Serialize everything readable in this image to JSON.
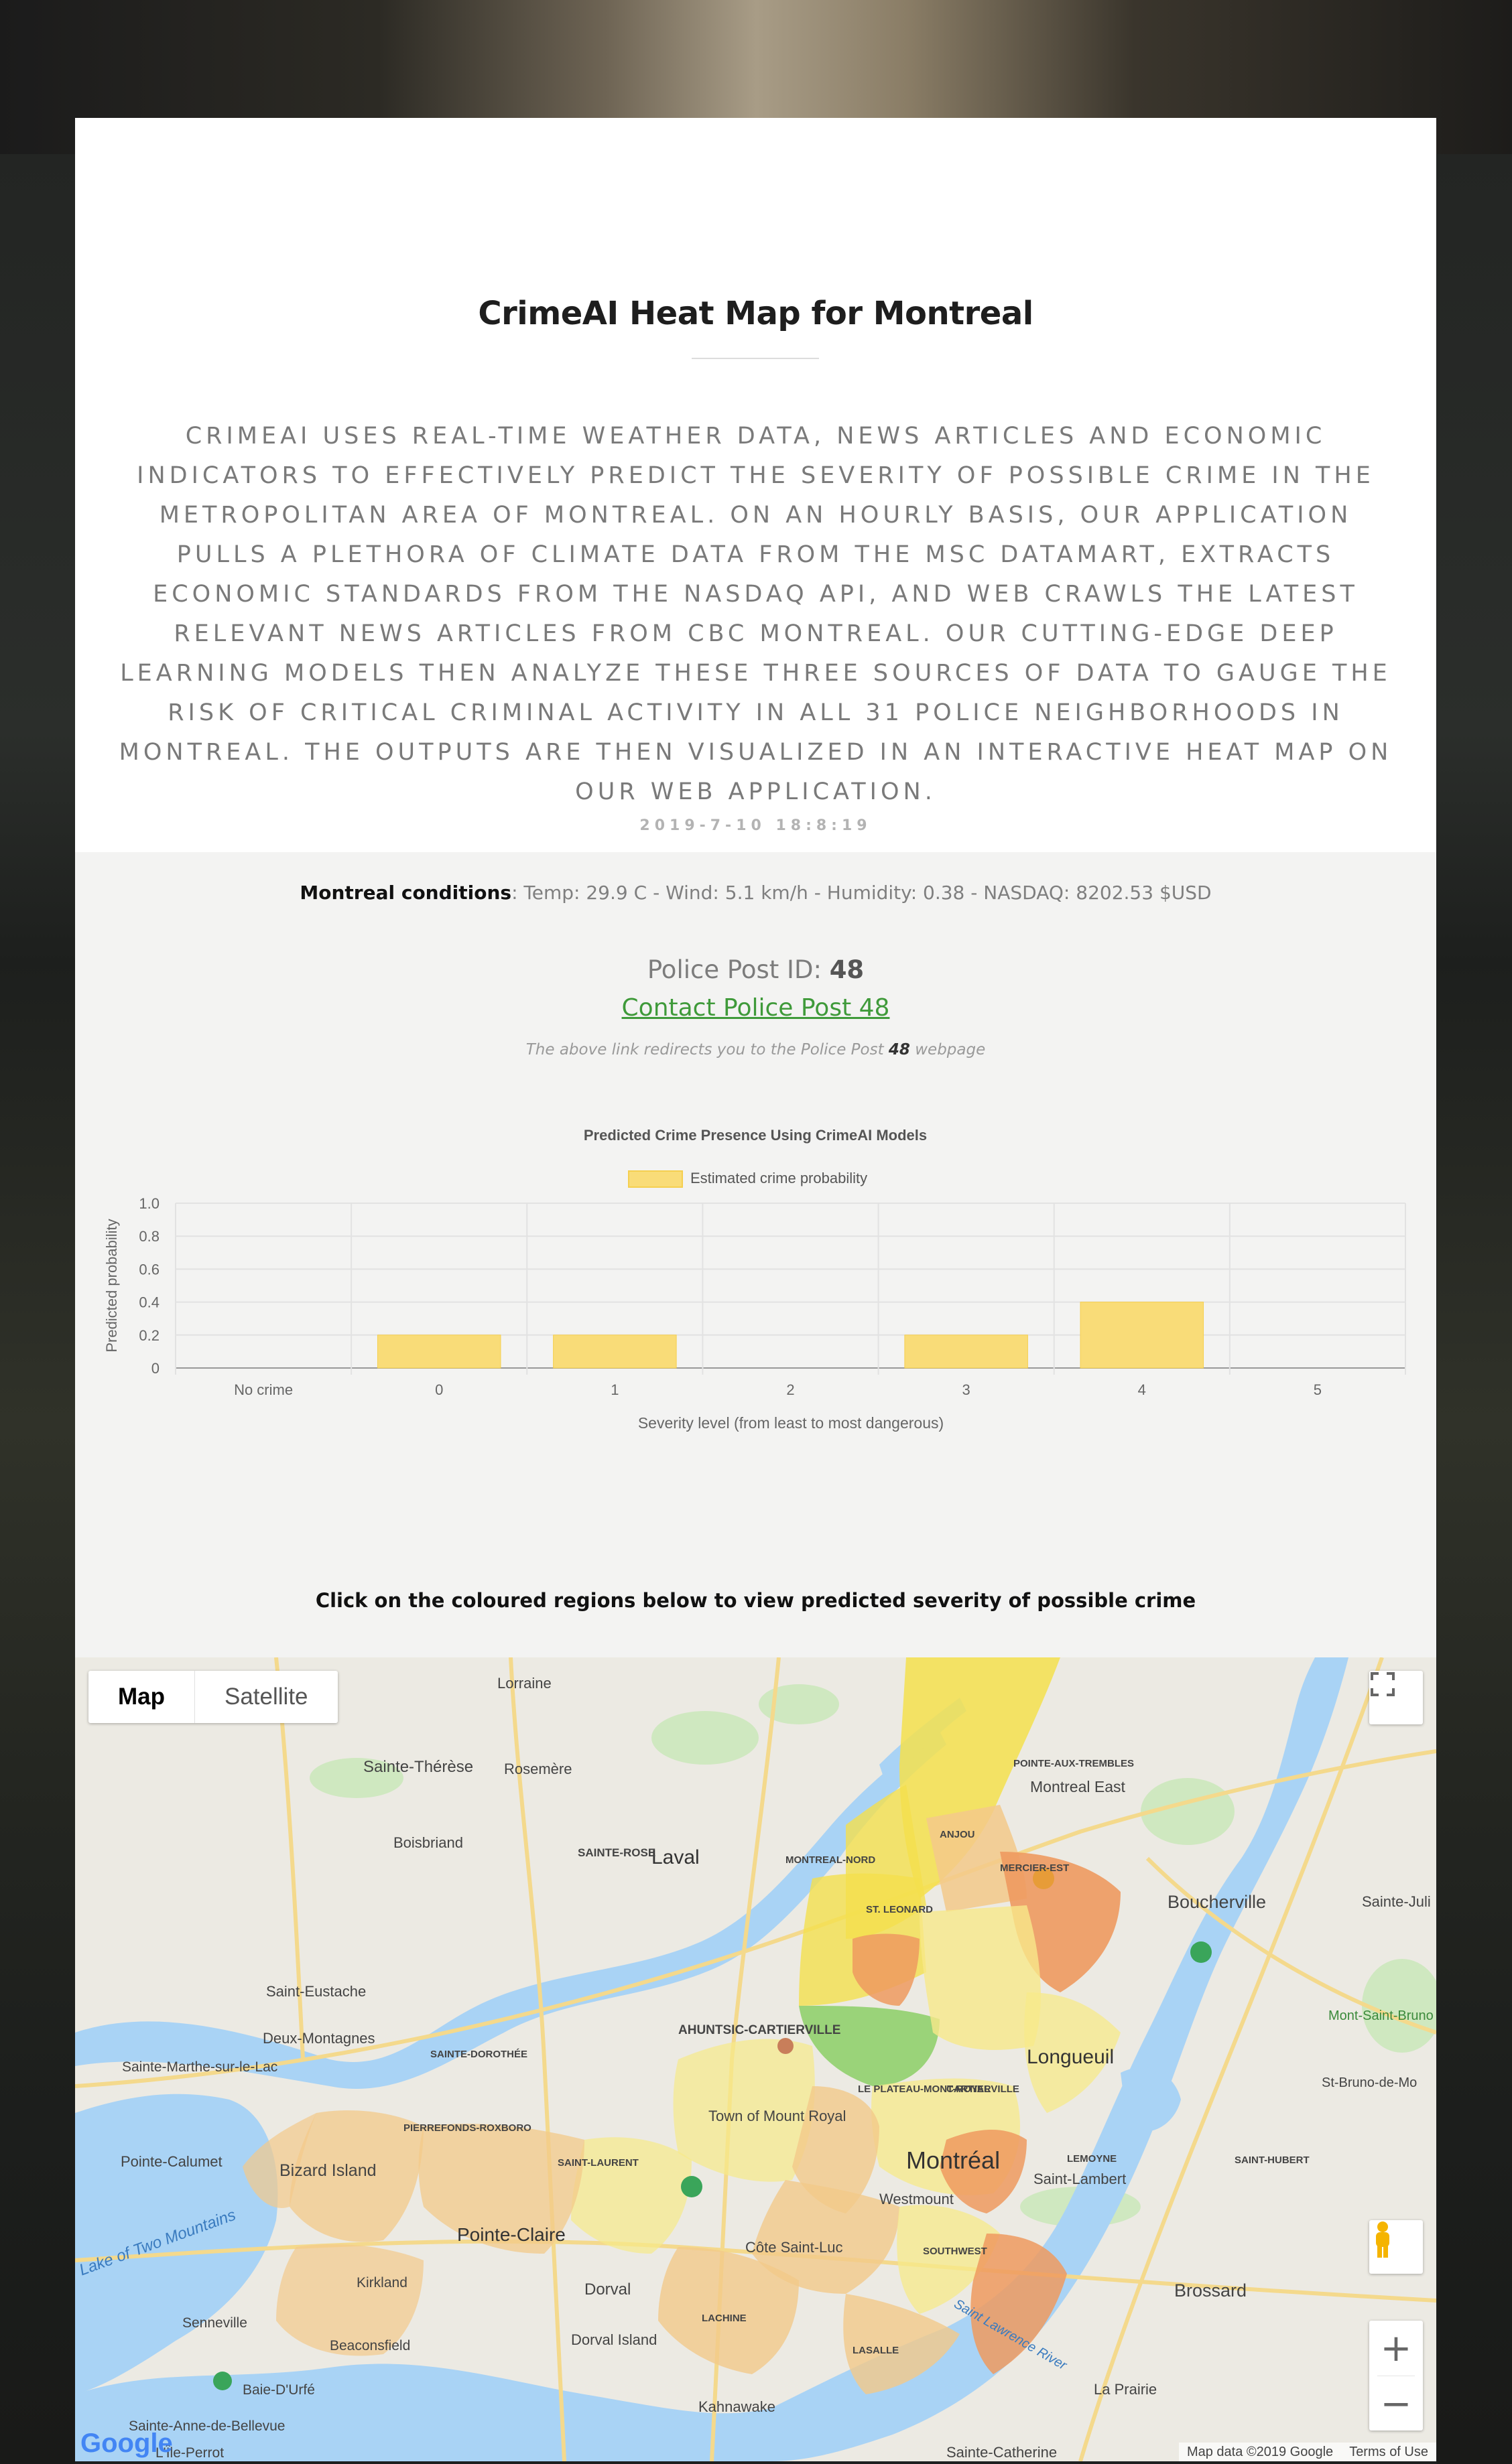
{
  "page": {
    "title": "CrimeAI Heat Map for Montreal",
    "description": "CrimeAI uses real-time weather data, news articles and economic indicators to effectively predict the severity of possible crime in the metropolitan area of Montreal. On an hourly basis, our application pulls a plethora of climate data from the MSC Datamart, extracts economic standards from the NASDAQ API, and web crawls the latest relevant news articles from CBC Montreal. Our cutting-edge deep learning models then analyze these three sources of data to gauge the risk of critical criminal activity in all 31 police neighborhoods in Montreal. The outputs are then visualized in an interactive heat map on our web application.",
    "timestamp": "2019-7-10 18:8:19"
  },
  "conditions": {
    "label": "Montreal conditions",
    "text": ": Temp: 29.9 C - Wind: 5.1 km/h - Humidity: 0.38 - NASDAQ: 8202.53 $USD"
  },
  "post": {
    "id_label": "Police Post ID: ",
    "id_value": "48",
    "contact_link": "Contact Police Post 48",
    "redirect_prefix": "The above link redirects you to the Police Post ",
    "redirect_id": "48",
    "redirect_suffix": " webpage"
  },
  "chart_data": {
    "type": "bar",
    "title": "Predicted Crime Presence Using CrimeAI Models",
    "categories": [
      "No crime",
      "0",
      "1",
      "2",
      "3",
      "4",
      "5"
    ],
    "series": [
      {
        "name": "Estimated crime probability",
        "values": [
          0,
          0.2,
          0.2,
          0,
          0.2,
          0.4,
          0
        ]
      }
    ],
    "xlabel": "Severity level (from least to most dangerous)",
    "ylabel": "Predicted probability",
    "ylim": [
      0,
      1.0
    ],
    "yticks": [
      "0",
      "0.2",
      "0.4",
      "0.6",
      "0.8",
      "1.0"
    ],
    "grid": true,
    "legend": "top-center",
    "bar_color": "#f9dc78",
    "bar_border": "#f5cf4f"
  },
  "map_section": {
    "hint": "Click on the coloured regions below to view predicted severity of possible crime",
    "map_tab": "Map",
    "satellite_tab": "Satellite",
    "zoom_in": "+",
    "zoom_out": "−",
    "attribution_data": "Map data ©2019 Google",
    "attribution_terms": "Terms of Use",
    "labels": {
      "laval": "Laval",
      "montreal": "Montréal",
      "longueuil": "Longueuil",
      "boucherville": "Boucherville",
      "brossard": "Brossard",
      "pointe_claire": "Pointe-Claire",
      "dorval": "Dorval",
      "bizard": "Bizard Island",
      "sainte_therese": "Sainte-Thérèse",
      "saint_lambert": "Saint-Lambert",
      "la_prairie": "La Prairie",
      "kahnawake": "Kahnawake",
      "montreal_est": "Montreal East",
      "boisbriand": "Boisbriand",
      "deux_montagnes": "Deux-Montagnes",
      "saint_eustache": "Saint-Eustache",
      "pointe_calumet": "Pointe-Calumet",
      "lake": "Lake of Two Mountains",
      "st_lawrence": "Saint Lawrence River",
      "sainte_catherine": "Sainte-Catherine",
      "dorval_island": "Dorval Island",
      "mont_saint_bruno": "Mont-Saint-Bruno National Park",
      "st_bruno": "St-Bruno-de-Mo",
      "rosemere": "Rosemère",
      "lorraine": "Lorraine",
      "westmount": "Westmount",
      "ahuntsic": "AHUNTSIC-CARTIERVILLE",
      "anjou": "ANJOU",
      "saint_laurent": "SAINT-LAURENT",
      "lachine": "LACHINE",
      "lasalle": "LASALLE",
      "verdun": "SOUTHWEST",
      "plateau": "LE PLATEAU-MONT-ROYAL",
      "st_leonard": "ST. LEONARD",
      "mercier": "MERCIER-EST",
      "montreal_nord": "MONTREAL-NORD",
      "pointe_trembles": "POINTE-AUX-TREMBLES",
      "pierrefonds": "PIERREFONDS-ROXBORO",
      "sainte_dorothee": "SAINTE-DOROTHÉE",
      "sainte_rose": "SAINTE-ROSE",
      "lemoyne": "LEMOYNE",
      "saint_hubert": "SAINT-HUBERT",
      "town_mount_royal": "Town of Mount Royal",
      "cote_saint_luc": "Côte Saint-Luc",
      "kirkland": "Kirkland",
      "beaconsfield": "Beaconsfield",
      "baie_durfe": "Baie-D'Urfé",
      "senneville": "Senneville",
      "sainte_anne": "Sainte-Anne-de-Bellevue",
      "ile_perrot": "L'Île-Perrot",
      "sainte_marthe": "Sainte-Marthe-sur-le-Lac",
      "cartierville": "CARTIERVILLE",
      "sainte_julie": "Sainte-Juli"
    },
    "google_logo": "Google"
  },
  "colors": {
    "card_bg": "#ffffff",
    "panel_bg": "#f3f3f2",
    "link_green": "#3f9a3a",
    "water": "#a9d3f5",
    "land": "#eceae3",
    "risk_low": "#f7e989",
    "risk_med": "#f3c98a",
    "risk_high": "#ee9a5f",
    "risk_green": "#8ccf66",
    "risk_yellow": "#f4e04e"
  }
}
